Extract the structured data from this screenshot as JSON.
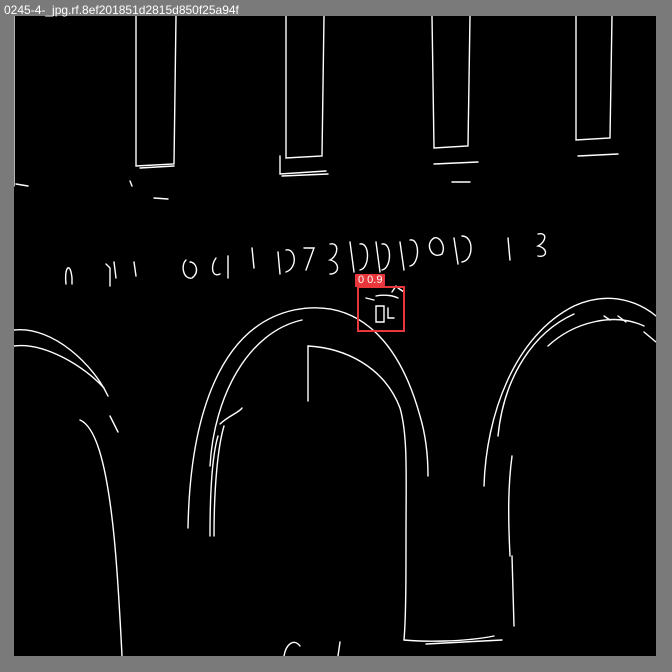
{
  "image": {
    "filename": "0245-4-_jpg.rf.8ef201851d2815d850f25a94f",
    "frame_color": "#7a7a7a",
    "background_color": "#000000",
    "edge_color": "#ffffff"
  },
  "detection": {
    "label": "0 0.9",
    "color": "#e8363a"
  }
}
